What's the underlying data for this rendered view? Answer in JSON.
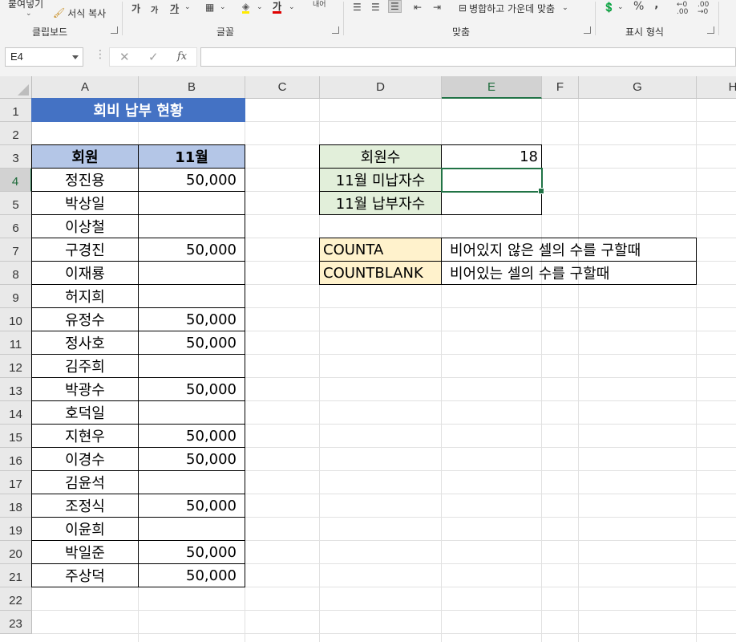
{
  "ribbon": {
    "paste_label": "붙여넣기",
    "format_painter_label": "서식 복사",
    "group_clipboard": "클립보드",
    "group_font": "글꼴",
    "group_alignment": "맞춤",
    "group_number": "표시 형식",
    "merge_center_label": "병합하고 가운데 맞춤",
    "font_increase": "가",
    "font_decrease": "가",
    "font_decrease2": "가",
    "font_color_glyph": "가",
    "percent_glyph": "%",
    "comma_glyph": "‚",
    "wrap_label": "내어",
    "accent_color": "#217346"
  },
  "formula_bar": {
    "name_box": "E4",
    "fx": "fx",
    "cancel": "✕",
    "enter": "✓",
    "formula": ""
  },
  "columns": [
    "A",
    "B",
    "C",
    "D",
    "E",
    "F",
    "G",
    "H"
  ],
  "selected_column": "E",
  "rows": [
    "1",
    "2",
    "3",
    "4",
    "5",
    "6",
    "7",
    "8",
    "9",
    "10",
    "11",
    "12",
    "13",
    "14",
    "15",
    "16",
    "17",
    "18",
    "19",
    "20",
    "21",
    "22",
    "23"
  ],
  "selected_row": "4",
  "sheet": {
    "title": "회비 납부 현황",
    "header_member": "회원",
    "header_month": "11월",
    "members": [
      {
        "name": "정진용",
        "amount": "50,000"
      },
      {
        "name": "박상일",
        "amount": ""
      },
      {
        "name": "이상철",
        "amount": ""
      },
      {
        "name": "구경진",
        "amount": "50,000"
      },
      {
        "name": "이재룡",
        "amount": ""
      },
      {
        "name": "허지희",
        "amount": ""
      },
      {
        "name": "유정수",
        "amount": "50,000"
      },
      {
        "name": "정사호",
        "amount": "50,000"
      },
      {
        "name": "김주희",
        "amount": ""
      },
      {
        "name": "박광수",
        "amount": "50,000"
      },
      {
        "name": "호덕일",
        "amount": ""
      },
      {
        "name": "지현우",
        "amount": "50,000"
      },
      {
        "name": "이경수",
        "amount": "50,000"
      },
      {
        "name": "김윤석",
        "amount": ""
      },
      {
        "name": "조정식",
        "amount": "50,000"
      },
      {
        "name": "이윤희",
        "amount": ""
      },
      {
        "name": "박일준",
        "amount": "50,000"
      },
      {
        "name": "주상덕",
        "amount": "50,000"
      }
    ],
    "summary": [
      {
        "label": "회원수",
        "value": "18"
      },
      {
        "label": "11월 미납자수",
        "value": ""
      },
      {
        "label": "11월 납부자수",
        "value": ""
      }
    ],
    "functions": [
      {
        "name": "COUNTA",
        "desc": "비어있지 않은 셀의 수를 구할때"
      },
      {
        "name": "COUNTBLANK",
        "desc": "비어있는 셀의 수를 구할때"
      }
    ],
    "colors": {
      "title_bg": "#4472c4",
      "header_bg": "#b4c6e7",
      "summary_bg": "#e2efda",
      "function_bg": "#fff2cc",
      "selection": "#217346"
    }
  }
}
